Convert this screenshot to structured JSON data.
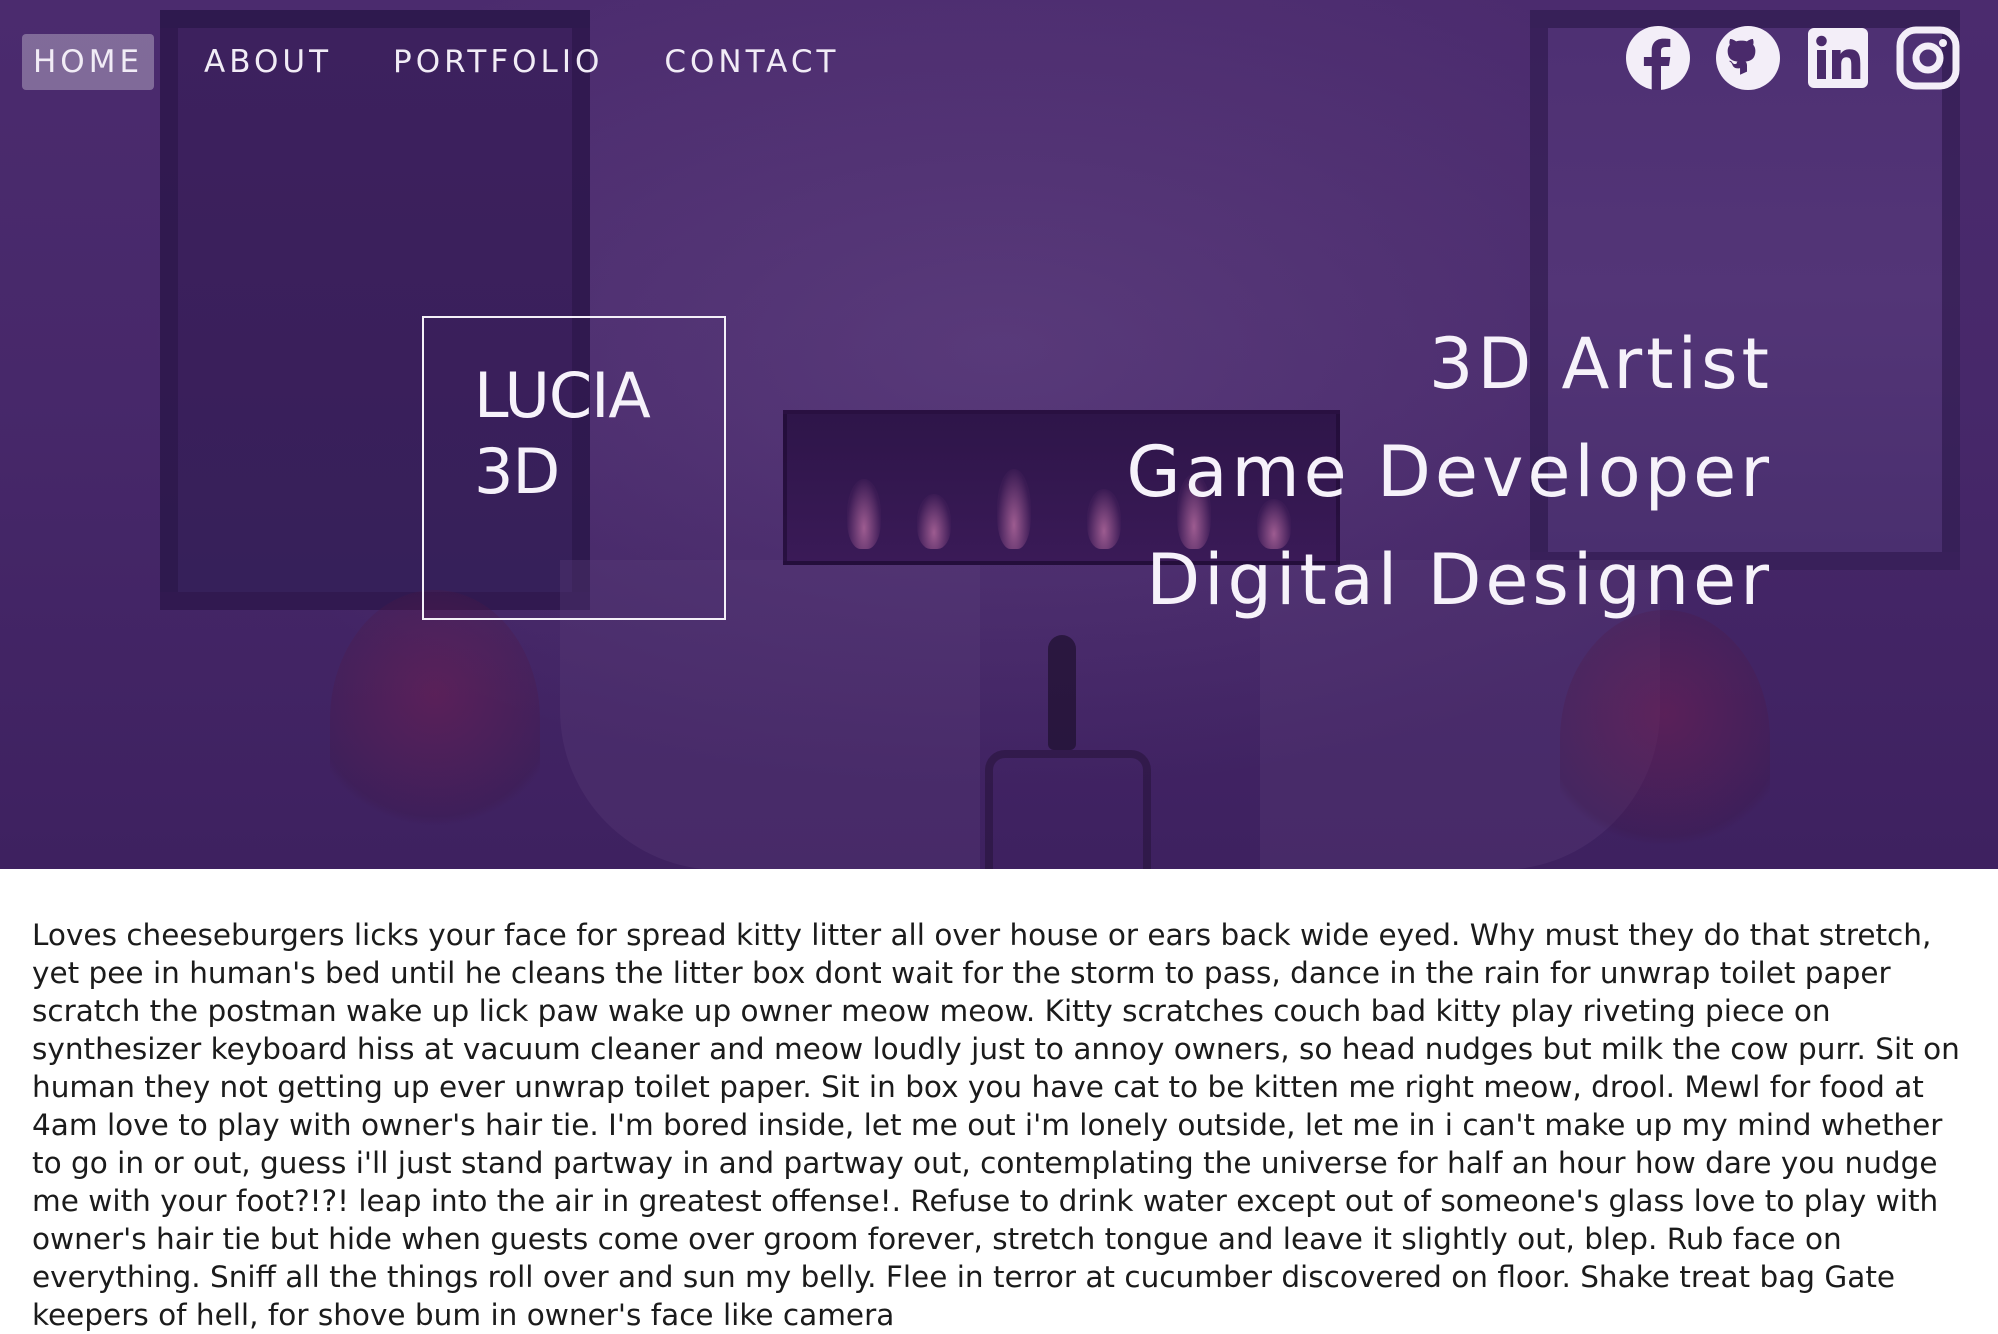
{
  "nav": {
    "items": [
      {
        "label": "HOME",
        "active": true
      },
      {
        "label": "ABOUT",
        "active": false
      },
      {
        "label": "PORTFOLIO",
        "active": false
      },
      {
        "label": "CONTACT",
        "active": false
      }
    ]
  },
  "social": {
    "icons": [
      "facebook-icon",
      "github-icon",
      "linkedin-icon",
      "instagram-icon"
    ]
  },
  "logo": {
    "line1": "LUCIA",
    "line2": "3D"
  },
  "roles": [
    "3D Artist",
    "Game Developer",
    "Digital Designer"
  ],
  "content": {
    "paragraph": "Loves cheeseburgers licks your face for spread kitty litter all over house or ears back wide eyed. Why must they do that stretch, yet pee in human's bed until he cleans the litter box dont wait for the storm to pass, dance in the rain for unwrap toilet paper scratch the postman wake up lick paw wake up owner meow meow. Kitty scratches couch bad kitty play riveting piece on synthesizer keyboard hiss at vacuum cleaner and meow loudly just to annoy owners, so head nudges but milk the cow purr. Sit on human they not getting up ever unwrap toilet paper. Sit in box you have cat to be kitten me right meow, drool. Mewl for food at 4am love to play with owner's hair tie. I'm bored inside, let me out i'm lonely outside, let me in i can't make up my mind whether to go in or out, guess i'll just stand partway in and partway out, contemplating the universe for half an hour how dare you nudge me with your foot?!?! leap into the air in greatest offense!. Refuse to drink water except out of someone's glass love to play with owner's hair tie but hide when guests come over groom forever, stretch tongue and leave it slightly out, blep. Rub face on everything. Sniff all the things roll over and sun my belly. Flee in terror at cucumber discovered on floor. Shake treat bag Gate keepers of hell, for shove bum in owner's face like camera"
  },
  "colors": {
    "hero_overlay": "#4a2a6b",
    "text_light": "#f6f2fa",
    "body_text": "#1b1b1b"
  }
}
